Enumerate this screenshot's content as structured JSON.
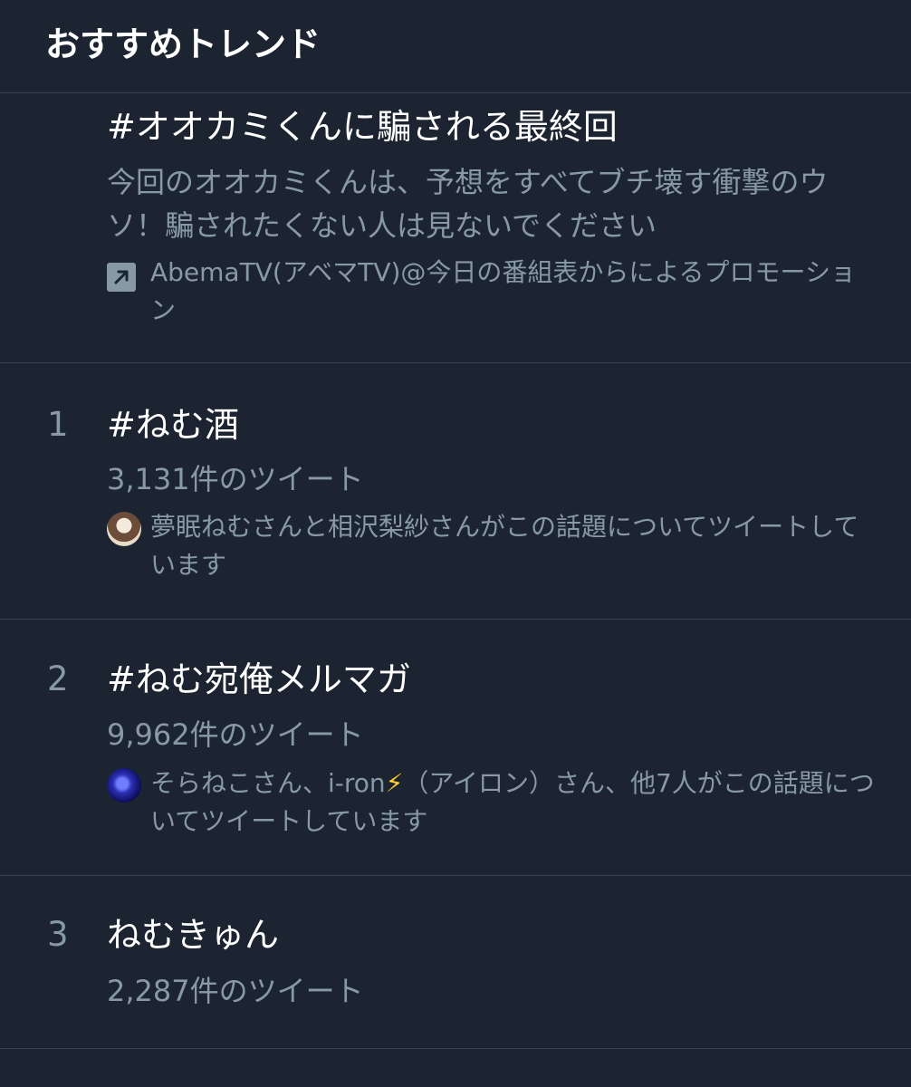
{
  "header": {
    "title": "おすすめトレンド"
  },
  "promoted": {
    "title": "#オオカミくんに騙される最終回",
    "description": "今回のオオカミくんは、予想をすべてブチ壊す衝撃のウソ！騙されたくない人は見ないでください",
    "promoted_by": "AbemaTV(アベマTV)@今日の番組表からによるプロモーション",
    "icon": "promoted-arrow-icon"
  },
  "trends": [
    {
      "rank": "1",
      "title": "#ねむ酒",
      "count": "3,131件のツイート",
      "context": "夢眠ねむさんと相沢梨紗さんがこの話題についてツイートしています",
      "avatar": "user-avatar"
    },
    {
      "rank": "2",
      "title": "#ねむ宛俺メルマガ",
      "count": "9,962件のツイート",
      "context_before": "そらねこさん、i-ron",
      "context_emoji": "⚡",
      "context_after": "（アイロン）さん、他7人がこの話題についてツイートしています",
      "avatar": "user-avatar"
    },
    {
      "rank": "3",
      "title": "ねむきゅん",
      "count": "2,287件のツイート"
    }
  ],
  "colors": {
    "background": "#1b2430",
    "divider": "#38444d",
    "primary_text": "#ffffff",
    "secondary_text": "#8899a6"
  }
}
